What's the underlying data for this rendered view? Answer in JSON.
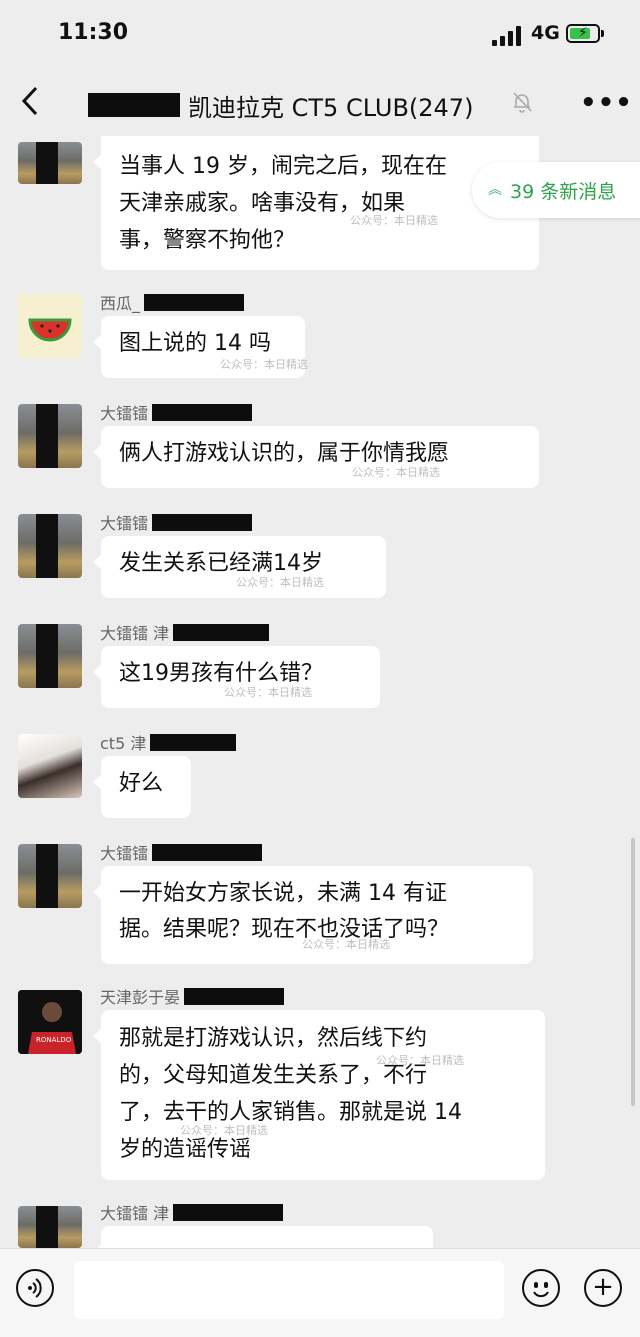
{
  "status_bar": {
    "time": "11:30",
    "network": "4G"
  },
  "header": {
    "title": "凯迪拉克 CT5  CLUB(247)"
  },
  "new_messages": {
    "label": "39 条新消息"
  },
  "watermark": "公众号：本日精选",
  "messages": [
    {
      "sender": "",
      "text": "当事人 19 岁，闹完之后，现在在天津亲戚家。啥事没有，如果事，警察不拘他？",
      "lines": [
        "当事人 19 岁，闹完之后，现在在",
        "天津亲戚家。啥事没有，如果",
        "事，警察不拘他？"
      ]
    },
    {
      "sender": "西瓜_",
      "text": "图上说的 14 吗"
    },
    {
      "sender": "大镭镭",
      "text": "俩人打游戏认识的，属于你情我愿"
    },
    {
      "sender": "大镭镭",
      "text": "发生关系已经满14岁"
    },
    {
      "sender": "大镭镭  津",
      "text": "这19男孩有什么错？"
    },
    {
      "sender": "ct5 津",
      "text": "好么"
    },
    {
      "sender": "大镭镭",
      "text": "一开始女方家长说，未满 14 有证据。结果呢？现在不也没话了吗？",
      "lines": [
        "一开始女方家长说，未满 14 有证",
        "据。结果呢？现在不也没话了吗？"
      ]
    },
    {
      "sender": "天津彭于晏",
      "text": "那就是打游戏认识，然后线下约的，父母知道发生关系了，不行了，去干的人家销售。那就是说14岁的造谣传谣",
      "lines": [
        "那就是打游戏认识，然后线下约",
        "的，父母知道发生关系了，不行",
        "了，去干的人家销售。那就是说 14",
        "岁的造谣传谣"
      ]
    },
    {
      "sender": "大镭镭  津",
      "text": ""
    }
  ],
  "avatar_labels": {
    "ronaldo": "RONALDO"
  },
  "icons": {
    "back": "chevron-left-icon",
    "mute": "bell-muted-icon",
    "more": "more-dots-icon",
    "voice": "voice-icon",
    "emoji": "emoji-icon",
    "plus": "plus-icon"
  },
  "colors": {
    "accent_green": "#2ea44f",
    "background": "#ededed",
    "bubble": "#ffffff"
  }
}
